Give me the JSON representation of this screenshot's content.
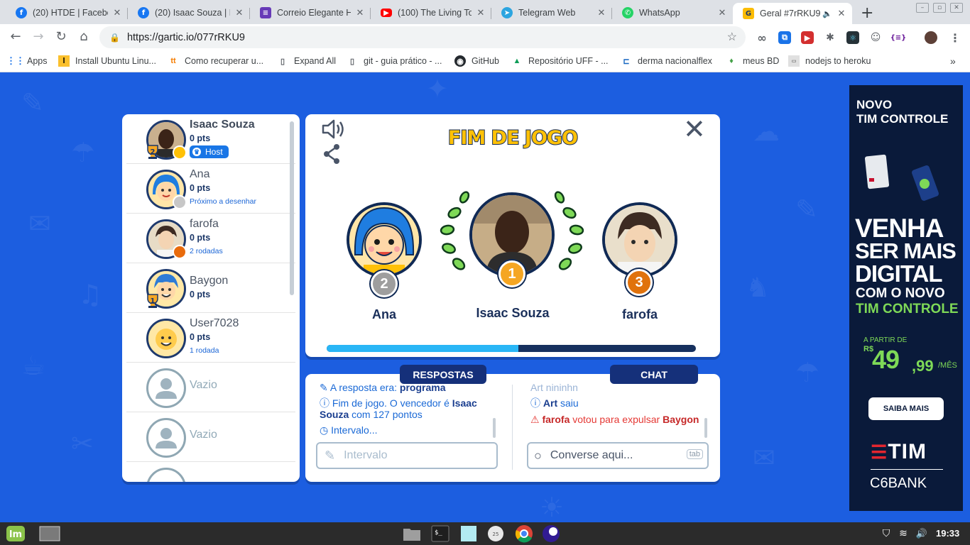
{
  "browser": {
    "tabs": [
      {
        "title": "(20) HTDE | Facebo",
        "icon": "facebook-icon",
        "color": "#1877f2"
      },
      {
        "title": "(20) Isaac Souza | F",
        "icon": "facebook-icon",
        "color": "#1877f2"
      },
      {
        "title": "Correio Elegante H",
        "icon": "forms-icon",
        "color": "#673ab7"
      },
      {
        "title": "(100) The Living To",
        "icon": "youtube-icon",
        "color": "#ff0000"
      },
      {
        "title": "Telegram Web",
        "icon": "telegram-icon",
        "color": "#2ca5e0"
      },
      {
        "title": "WhatsApp",
        "icon": "whatsapp-icon",
        "color": "#25d366"
      },
      {
        "title": "Geral #7rRKU9",
        "icon": "gartic-icon",
        "color": "#fbbc05",
        "active": true
      }
    ],
    "url": "https://gartic.io/077rRKU9",
    "bookmarks": [
      {
        "label": "Apps"
      },
      {
        "label": "Install Ubuntu Linu..."
      },
      {
        "label": "Como recuperar u..."
      },
      {
        "label": "Expand All"
      },
      {
        "label": "git - guia prático - ..."
      },
      {
        "label": "GitHub"
      },
      {
        "label": "Repositório UFF - ..."
      },
      {
        "label": "derma nacionalflex"
      },
      {
        "label": "meus BD"
      },
      {
        "label": "nodejs to heroku"
      }
    ],
    "bookmarks_overflow": "»"
  },
  "players": [
    {
      "name": "Isaac Souza",
      "points": "0 pts",
      "badge": "Host",
      "trophy": "2",
      "dot_color": "#ffc107"
    },
    {
      "name": "Ana",
      "points": "0 pts",
      "sub": "Próximo a desenhar",
      "dot_color": "#c7c7c7"
    },
    {
      "name": "farofa",
      "points": "0 pts",
      "sub": "2 rodadas",
      "dot_color": "#e96b0c"
    },
    {
      "name": "Baygon",
      "points": "0 pts",
      "trophy": "1"
    },
    {
      "name": "User7028",
      "points": "0 pts",
      "sub": "1 rodada"
    },
    {
      "name": "Vazio"
    },
    {
      "name": "Vazio"
    }
  ],
  "results": {
    "title": "FIM DE JOGO",
    "podium": [
      {
        "place": "1",
        "name": "Isaac Souza",
        "medal_color": "#f5a623"
      },
      {
        "place": "2",
        "name": "Ana",
        "medal_color": "#9e9e9e"
      },
      {
        "place": "3",
        "name": "farofa",
        "medal_color": "#e0720c"
      }
    ],
    "progress_fraction": 0.52
  },
  "answers": {
    "tab_label": "RESPOSTAS",
    "msg_partial_prefix": "A resposta era: ",
    "msg_partial_answer": "programa",
    "msg_end_prefix": "Fim de jogo. O vencedor é ",
    "msg_end_winner": "Isaac Souza",
    "msg_end_suffix": " com 127 pontos",
    "msg_interval": "Intervalo...",
    "input_placeholder": "Intervalo"
  },
  "chat": {
    "tab_label": "CHAT",
    "msg_partial": "Art nininhn",
    "msg_left_name": "Art",
    "msg_left_suffix": " saiu",
    "msg_vote_name": "farofa",
    "msg_vote_text": " votou para expulsar ",
    "msg_vote_target": "Baygon",
    "input_placeholder": "Converse aqui...",
    "tab_hint": "tab"
  },
  "ad": {
    "line1": "NOVO",
    "line2": "TIM CONTROLE",
    "big1": "VENHA",
    "big2": "SER MAIS",
    "big3": "DIGITAL",
    "mid1": "COM O NOVO",
    "mid2": "TIM CONTROLE",
    "price_label": "A PARTIR DE",
    "currency": "R$",
    "price": "49",
    "cents": ",99",
    "per": "/MÊS",
    "cta": "SAIBA MAIS",
    "brand1": "TIM",
    "brand2": "C6BANK"
  },
  "taskbar": {
    "clock": "19:33",
    "calendar_day": "25"
  }
}
